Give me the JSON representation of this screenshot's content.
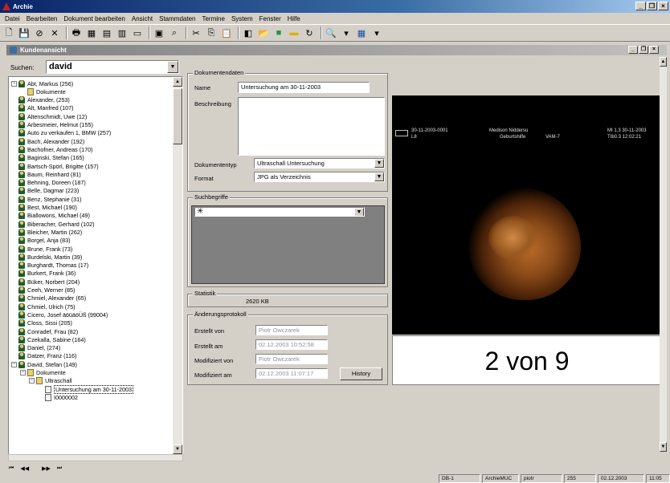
{
  "app": {
    "title": "Archie"
  },
  "menu": [
    "Datei",
    "Bearbeiten",
    "Dokument bearbeiten",
    "Ansicht",
    "Stammdaten",
    "Termine",
    "System",
    "Fenster",
    "Hilfe"
  ],
  "child_window": {
    "title": "Kundenansicht"
  },
  "search": {
    "label": "Suchen:",
    "value": "david"
  },
  "tree": [
    {
      "label": "Abt, Markus (256)",
      "kind": "person",
      "level": 0,
      "expander": "−"
    },
    {
      "label": "Dokumente",
      "kind": "folder",
      "level": 1
    },
    {
      "label": "Alexander, (253)",
      "kind": "person",
      "level": 0
    },
    {
      "label": "Alt, Manfred (107)",
      "kind": "person",
      "level": 0
    },
    {
      "label": "Altenschmidt, Uwe (12)",
      "kind": "person",
      "level": 0
    },
    {
      "label": "Arbesmeier, Helmut (155)",
      "kind": "person",
      "level": 0
    },
    {
      "label": "Auto zu verkaufen 1, BMW (257)",
      "kind": "person",
      "level": 0
    },
    {
      "label": "Bach, Alexander (192)",
      "kind": "person",
      "level": 0
    },
    {
      "label": "Bachofner, Andreas (170)",
      "kind": "person",
      "level": 0
    },
    {
      "label": "Baginski, Stefan (165)",
      "kind": "person",
      "level": 0
    },
    {
      "label": "Bartsch-Spörl, Brigitte (157)",
      "kind": "person",
      "level": 0
    },
    {
      "label": "Baum, Reinhard (81)",
      "kind": "person",
      "level": 0
    },
    {
      "label": "Behning, Doreen (187)",
      "kind": "person",
      "level": 0
    },
    {
      "label": "Belle, Dagmar (223)",
      "kind": "person",
      "level": 0
    },
    {
      "label": "Benz, Stephanie (31)",
      "kind": "person",
      "level": 0
    },
    {
      "label": "Best, Michael (190)",
      "kind": "person",
      "level": 0
    },
    {
      "label": "Biallowons, Michael (49)",
      "kind": "person",
      "level": 0
    },
    {
      "label": "Biberacher, Gerhard (102)",
      "kind": "person",
      "level": 0
    },
    {
      "label": "Bleicher, Martin (262)",
      "kind": "person",
      "level": 0
    },
    {
      "label": "Borgel, Anja (83)",
      "kind": "person",
      "level": 0
    },
    {
      "label": "Brune, Frank (73)",
      "kind": "person",
      "level": 0
    },
    {
      "label": "Burdelski, Martin (39)",
      "kind": "person",
      "level": 0
    },
    {
      "label": "Burghardt, Thomas (17)",
      "kind": "person",
      "level": 0
    },
    {
      "label": "Burkert, Frank (36)",
      "kind": "person",
      "level": 0
    },
    {
      "label": "Büker, Norbert (204)",
      "kind": "person",
      "level": 0
    },
    {
      "label": "Ceeh, Werner (85)",
      "kind": "person",
      "level": 0
    },
    {
      "label": "Chmiel, Alexander (65)",
      "kind": "person",
      "level": 0
    },
    {
      "label": "Chmiel, Ulrich (75)",
      "kind": "person",
      "level": 0
    },
    {
      "label": "Cicero, Josef äöüäöÜß (99004)",
      "kind": "person",
      "level": 0
    },
    {
      "label": "Closs, Sissi (205)",
      "kind": "person",
      "level": 0
    },
    {
      "label": "Conradef, Frau (82)",
      "kind": "person",
      "level": 0
    },
    {
      "label": "Czekalla, Sabine (164)",
      "kind": "person",
      "level": 0
    },
    {
      "label": "Daniel, (274)",
      "kind": "person",
      "level": 0
    },
    {
      "label": "Datzer, Franz (116)",
      "kind": "person",
      "level": 0
    },
    {
      "label": "David, Stefan (149)",
      "kind": "person",
      "level": 0,
      "expander": "−"
    },
    {
      "label": "Dokumente",
      "kind": "folder",
      "level": 1,
      "expander": "−"
    },
    {
      "label": "Ultraschall",
      "kind": "folder",
      "level": 2,
      "expander": "−"
    },
    {
      "label": "Untersuchung am 30-11-2003",
      "kind": "doc",
      "level": 3,
      "selected": true
    },
    {
      "label": "I0000002",
      "kind": "doc",
      "level": 3
    }
  ],
  "doc": {
    "group_title": "Dokumentendaten",
    "name_label": "Name",
    "name_value": "Untersuchung am 30-11-2003",
    "desc_label": "Beschreibung",
    "type_label": "Dokumententyp",
    "type_value": "Ultraschall Untersuchung",
    "format_label": "Format",
    "format_value": "JPG als Verzeichnis"
  },
  "keywords": {
    "group_title": "Suchbegriffe"
  },
  "stats": {
    "group_title": "Statistik",
    "size": "2620 KB"
  },
  "log": {
    "group_title": "Änderungsprotokoll",
    "created_by_label": "Erstellt von",
    "created_by": "Piotr Owczarek",
    "created_at_label": "Erstellt am",
    "created_at": "02.12.2003 10:52:58",
    "modified_by_label": "Modifiziert von",
    "modified_by": "Piotr Owczarek",
    "modified_at_label": "Modifiziert am",
    "modified_at": "02.12.2003 11:07:17",
    "history_button": "History"
  },
  "viewer": {
    "ov_left1": "30-11-2003-0001",
    "ov_left2": "L8",
    "ov_center1": "Medison Niddersu",
    "ov_center2": "Geburtshilfe",
    "ov_center3": "VAM-7",
    "ov_right1": "MI 1.3 30-11-2003",
    "ov_right2": "TIb0.3 12:02:21",
    "page_counter": "2 von 9"
  },
  "status": [
    "DB-1",
    "ArchieMUC",
    "piotr",
    "255",
    "02.12.2003",
    "11:05"
  ]
}
